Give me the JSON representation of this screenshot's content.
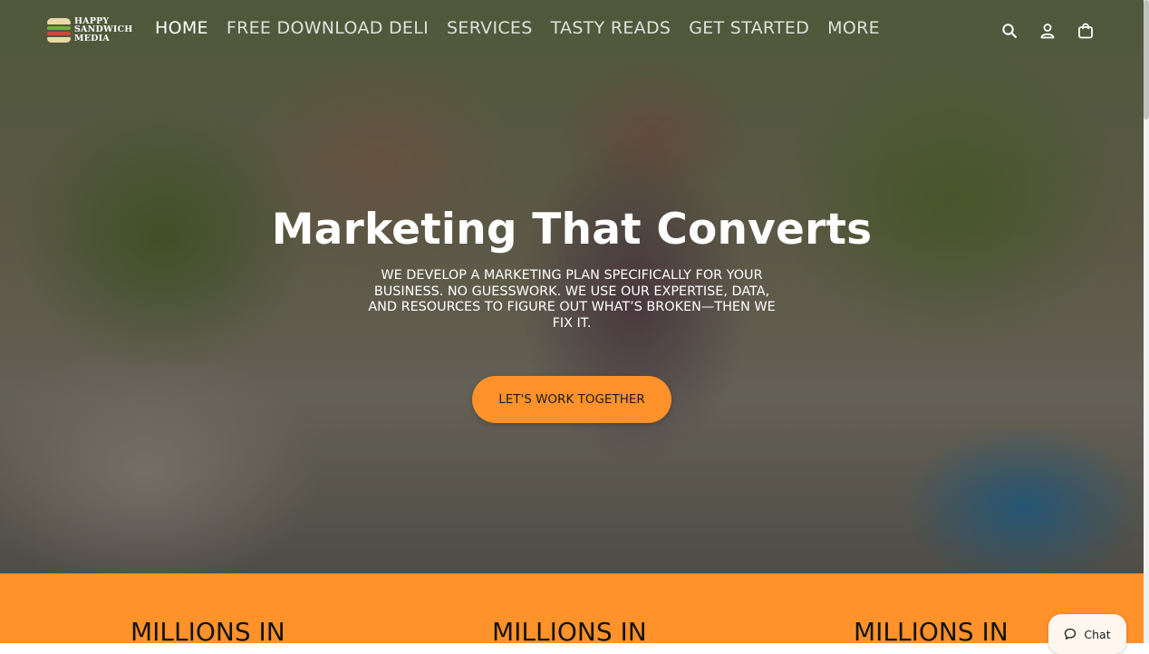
{
  "brand": {
    "logo_line1": "HAPPY",
    "logo_line2": "SANDWICH",
    "logo_line3": "MEDIA"
  },
  "nav": {
    "items": [
      {
        "label": "HOME"
      },
      {
        "label": "FREE DOWNLOAD DELI"
      },
      {
        "label": "SERVICES"
      },
      {
        "label": "TASTY READS"
      },
      {
        "label": "GET STARTED"
      },
      {
        "label": "MORE"
      }
    ]
  },
  "header_icons": [
    "search-icon",
    "account-icon",
    "cart-icon"
  ],
  "hero": {
    "title": "Marketing That Converts",
    "subtitle": "WE DEVELOP A MARKETING PLAN SPECIFICALLY FOR YOUR BUSINESS. NO GUESSWORK. WE USE OUR EXPERTISE, DATA, AND RESOURCES TO FIGURE OUT WHAT’S BROKEN—THEN WE FIX IT.",
    "cta": "LET'S WORK TOGETHER"
  },
  "stats": [
    {
      "label": "MILLIONS IN"
    },
    {
      "label": "MILLIONS IN"
    },
    {
      "label": "MILLIONS IN"
    }
  ],
  "chat": {
    "label": "Chat"
  },
  "colors": {
    "accent": "#ff922b",
    "text_light": "#ffffff"
  }
}
